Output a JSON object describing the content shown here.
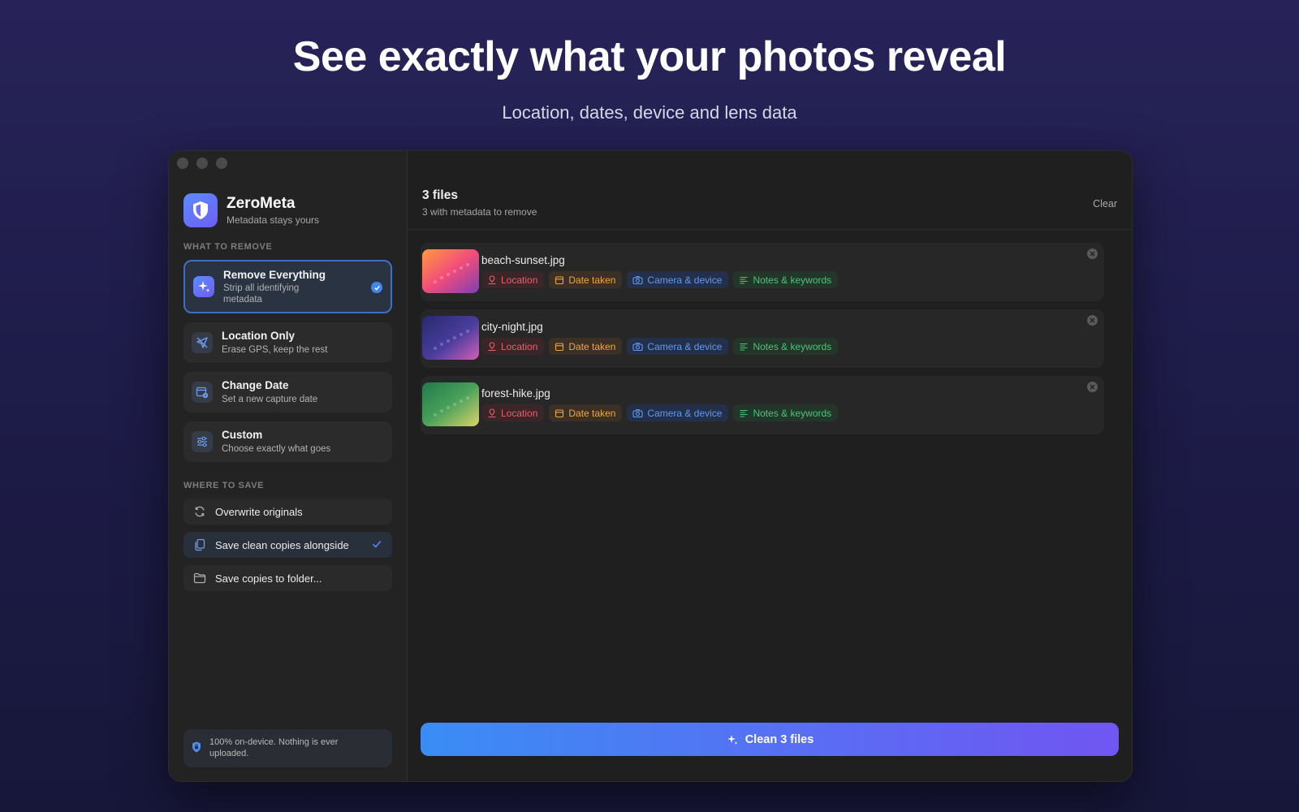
{
  "hero": {
    "title": "See exactly what your photos reveal",
    "subtitle": "Location, dates, device and lens data"
  },
  "app": {
    "name": "ZeroMeta",
    "tagline": "Metadata stays yours"
  },
  "sidebar": {
    "remove_section_label": "WHAT TO REMOVE",
    "modes": [
      {
        "title": "Remove Everything",
        "desc": "Strip all identifying metadata",
        "selected": true,
        "icon": "sparkles-icon"
      },
      {
        "title": "Location Only",
        "desc": "Erase GPS, keep the rest",
        "selected": false,
        "icon": "location-off-icon"
      },
      {
        "title": "Change Date",
        "desc": "Set a new capture date",
        "selected": false,
        "icon": "calendar-clock-icon"
      },
      {
        "title": "Custom",
        "desc": "Choose exactly what goes",
        "selected": false,
        "icon": "sliders-icon"
      }
    ],
    "save_section_label": "WHERE TO SAVE",
    "save_options": [
      {
        "label": "Overwrite originals",
        "selected": false,
        "icon": "refresh-icon"
      },
      {
        "label": "Save clean copies alongside",
        "selected": true,
        "icon": "copy-icon"
      },
      {
        "label": "Save copies to folder...",
        "selected": false,
        "icon": "folder-icon"
      }
    ],
    "privacy_note": "100% on-device. Nothing is ever uploaded."
  },
  "main": {
    "files_count": "3 files",
    "files_sub": "3 with metadata to remove",
    "clear_label": "Clear",
    "chip_labels": {
      "location": "Location",
      "date": "Date taken",
      "camera": "Camera & device",
      "notes": "Notes & keywords"
    },
    "files": [
      {
        "name": "beach-sunset.jpg"
      },
      {
        "name": "city-night.jpg"
      },
      {
        "name": "forest-hike.jpg"
      }
    ],
    "cta_label": "Clean 3 files"
  },
  "colors": {
    "accent": "#3f86ee",
    "location": "#ee5e6a",
    "date": "#f2a53c",
    "camera": "#5e9bf4",
    "notes": "#4cc47b"
  }
}
